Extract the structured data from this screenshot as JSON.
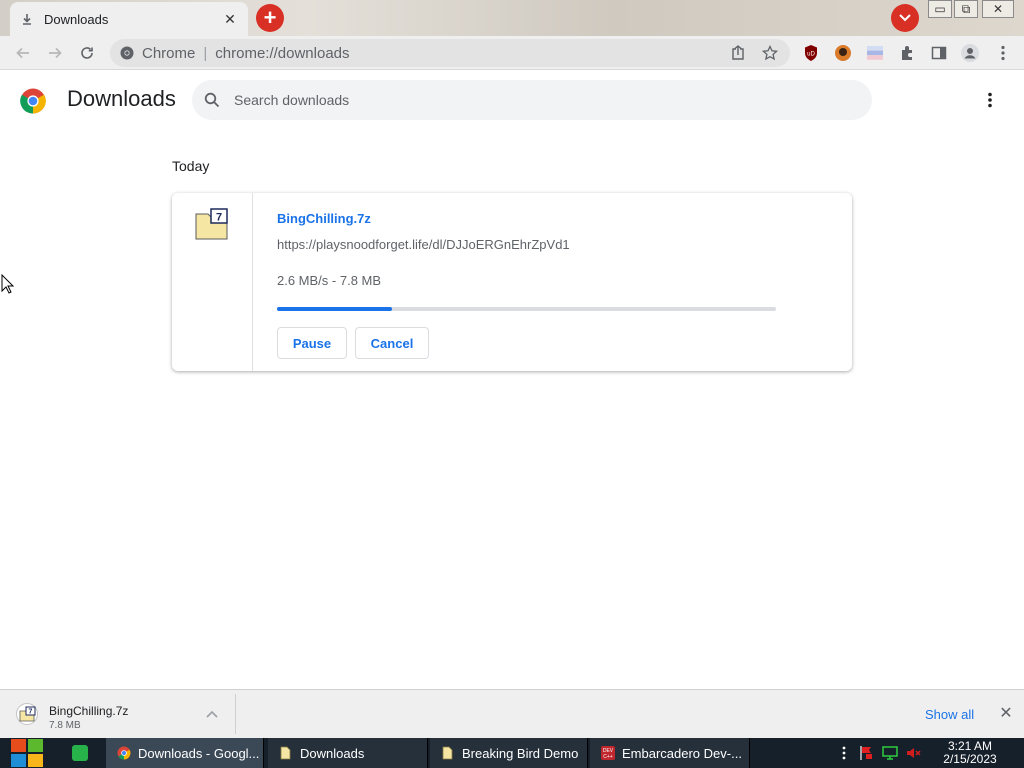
{
  "browser": {
    "tab": {
      "title": "Downloads",
      "close": "✕"
    },
    "omnibox": {
      "site_name": "Chrome",
      "divider": "|",
      "url": "chrome://downloads"
    },
    "window_buttons": {
      "minimize": "▭",
      "maximize": "⧉",
      "close": "✕"
    }
  },
  "page": {
    "title": "Downloads",
    "search": {
      "placeholder": "Search downloads",
      "value": ""
    }
  },
  "downloads": {
    "date_header": "Today",
    "item": {
      "file_name": "BingChilling.7z",
      "url": "https://playsnoodforget.life/dl/DJJoERGnEhrZpVd1",
      "status": "2.6 MB/s - 7.8 MB",
      "progress_fraction": 0.23,
      "pause_label": "Pause",
      "cancel_label": "Cancel"
    }
  },
  "shelf": {
    "file_name": "BingChilling.7z",
    "file_size": "7.8 MB",
    "show_all_label": "Show all",
    "close": "✕"
  },
  "taskbar": {
    "items": [
      {
        "label": "Downloads - Googl..."
      },
      {
        "label": "Downloads"
      },
      {
        "label": "Breaking Bird Demo"
      },
      {
        "label": "Embarcadero Dev-..."
      }
    ],
    "clock": {
      "time": "3:21 AM",
      "date": "2/15/2023"
    }
  },
  "colors": {
    "accent_blue": "#1a73e8",
    "progress_track": "#dadce0",
    "red_button": "#d93025",
    "taskbar_bg": "#16202a"
  },
  "icons": {
    "tab_favicon": "download-icon",
    "new_tab": "plus-icon",
    "tab_search": "chevron-down-icon",
    "site_info": "chrome-icon",
    "share": "share-icon",
    "bookmark": "star-icon",
    "menu": "more-vert-icon",
    "search": "search-icon",
    "file": "7z-archive-icon"
  }
}
